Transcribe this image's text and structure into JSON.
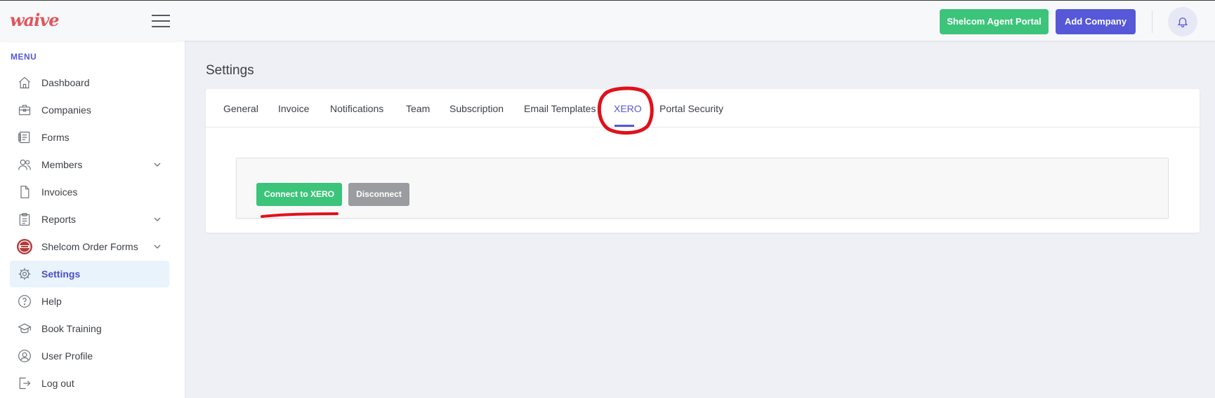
{
  "app": {
    "logo_text": "waive",
    "agent_portal_label": "Shelcom Agent Portal",
    "add_company_label": "Add Company"
  },
  "sidebar": {
    "menu_title": "MENU",
    "items": [
      {
        "label": "Dashboard",
        "icon": "home-icon"
      },
      {
        "label": "Companies",
        "icon": "briefcase-icon"
      },
      {
        "label": "Forms",
        "icon": "forms-icon"
      },
      {
        "label": "Members",
        "icon": "members-icon",
        "has_chevron": true
      },
      {
        "label": "Invoices",
        "icon": "file-icon"
      },
      {
        "label": "Reports",
        "icon": "clipboard-icon",
        "has_chevron": true
      },
      {
        "label": "Shelcom Order Forms",
        "icon": "shelcom-logo-icon",
        "has_chevron": true
      },
      {
        "label": "Settings",
        "icon": "gear-icon",
        "active": true
      },
      {
        "label": "Help",
        "icon": "help-icon"
      },
      {
        "label": "Book Training",
        "icon": "graduation-cap-icon"
      },
      {
        "label": "User Profile",
        "icon": "user-icon"
      },
      {
        "label": "Log out",
        "icon": "logout-icon"
      }
    ]
  },
  "main": {
    "title": "Settings",
    "tabs": [
      {
        "label": "General"
      },
      {
        "label": "Invoice"
      },
      {
        "label": "Notifications"
      },
      {
        "label": "Team"
      },
      {
        "label": "Subscription"
      },
      {
        "label": "Email Templates"
      },
      {
        "label": "XERO",
        "active": true
      },
      {
        "label": "Portal Security"
      }
    ],
    "connect_label": "Connect to XERO",
    "disconnect_label": "Disconnect"
  },
  "colors": {
    "accent": "#5658d8",
    "success": "#3cc47a",
    "muted": "#9a9ca0",
    "annotation": "#e0111b",
    "logo": "#e0555b"
  }
}
